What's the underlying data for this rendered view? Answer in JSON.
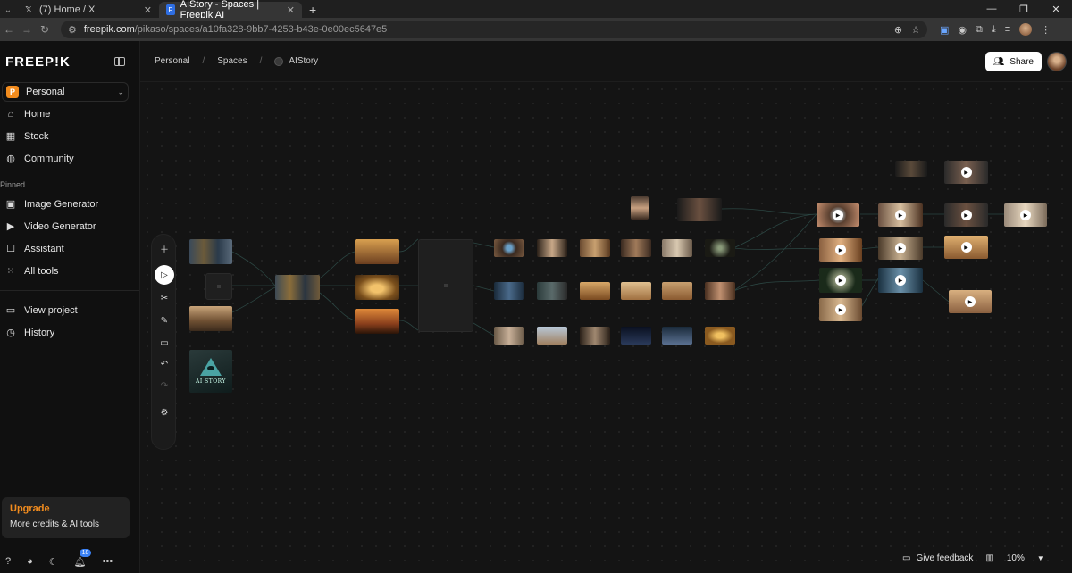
{
  "browser": {
    "tabs": [
      {
        "title": "(7) Home / X",
        "icon": "x-logo-icon",
        "active": false
      },
      {
        "title": "AIStory - Spaces | Freepik AI",
        "icon": "freepik-favicon-icon",
        "active": true
      }
    ],
    "url_main": "freepik.com",
    "url_path": "/pikaso/spaces/a10fa328-9bb7-4253-b43e-0e00ec5647e5"
  },
  "sidebar": {
    "logo": "FREEP!K",
    "workspace": {
      "badge": "P",
      "name": "Personal"
    },
    "nav": [
      {
        "label": "Home",
        "icon": "home-icon"
      },
      {
        "label": "Stock",
        "icon": "stock-icon"
      },
      {
        "label": "Community",
        "icon": "globe-icon"
      }
    ],
    "pinned_label": "Pinned",
    "pinned": [
      {
        "label": "Image Generator",
        "icon": "image-icon"
      },
      {
        "label": "Video Generator",
        "icon": "video-icon"
      },
      {
        "label": "Assistant",
        "icon": "chat-icon"
      },
      {
        "label": "All tools",
        "icon": "grid-icon"
      }
    ],
    "secondary": [
      {
        "label": "View project",
        "icon": "project-icon"
      },
      {
        "label": "History",
        "icon": "history-icon"
      }
    ],
    "upgrade": {
      "title": "Upgrade",
      "subtitle": "More credits & AI tools"
    },
    "notification_count": "18"
  },
  "header": {
    "breadcrumb": [
      "Personal",
      "Spaces",
      "AIStory"
    ],
    "share_label": "Share"
  },
  "canvas": {
    "logo_node_text": "AI STORY"
  },
  "footer": {
    "feedback_label": "Give feedback",
    "zoom": "10%"
  }
}
